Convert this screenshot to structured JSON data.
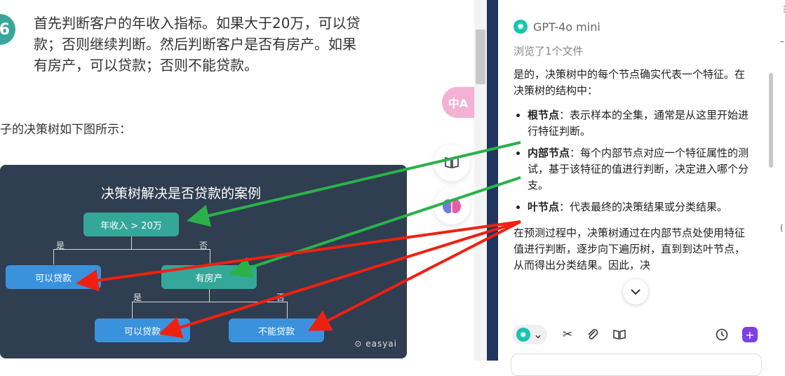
{
  "article": {
    "step_badge": "6",
    "paragraph_lines": [
      "首先判断客户的年收入指标。如果大于20万，可以贷",
      "款；否则继续判断。然后判断客户是否有房产。如果",
      "有房产，可以贷款；否则不能贷款。"
    ],
    "caption": "子的决策树如下图所示："
  },
  "diagram": {
    "title": "决策树解决是否贷款的案例",
    "root": "年收入 > 20万",
    "root_yes": "是",
    "root_no": "否",
    "left_leaf": "可以贷款",
    "middle_node": "有房产",
    "mid_yes": "是",
    "mid_no": "否",
    "bottom_left": "可以贷款",
    "bottom_right": "不能贷款",
    "brand": "easyai"
  },
  "side_tools": {
    "translate_label": "中A",
    "reader_icon": "book-open-icon",
    "brain_icon": "brain-icon"
  },
  "chat": {
    "model_name": "GPT-4o mini",
    "browse_text": "浏览了1个文件",
    "intro": "是的，决策树中的每个节点确实代表一个特征。在决策树的结构中：",
    "bullets": [
      {
        "term": "根节点",
        "desc": "：表示样本的全集，通常是从这里开始进行特征判断。"
      },
      {
        "term": "内部节点",
        "desc": "：每个内部节点对应一个特征属性的测试，基于该特征的值进行判断，决定进入哪个分支。"
      },
      {
        "term": "叶节点",
        "desc": "：代表最终的决策结果或分类结果。"
      }
    ],
    "after_text": "在预测过程中，决策树通过在内部节点处使用特征值进行判断，逐步向下遍历树，直到到达叶节点，从而得出分类结果。因此，决"
  },
  "toolbar": {
    "model_chevron": "⌄",
    "scissors": "✂",
    "attach": "🔗",
    "book": "📖",
    "history": "🕓",
    "new_chat": "+"
  },
  "colors": {
    "green_arrow": "#2bb14a",
    "red_arrow": "#f02010",
    "panel_border": "#1f3560",
    "teal_node": "#35a79a",
    "blue_node": "#3b92dc",
    "diagram_bg": "#2f3e50"
  }
}
